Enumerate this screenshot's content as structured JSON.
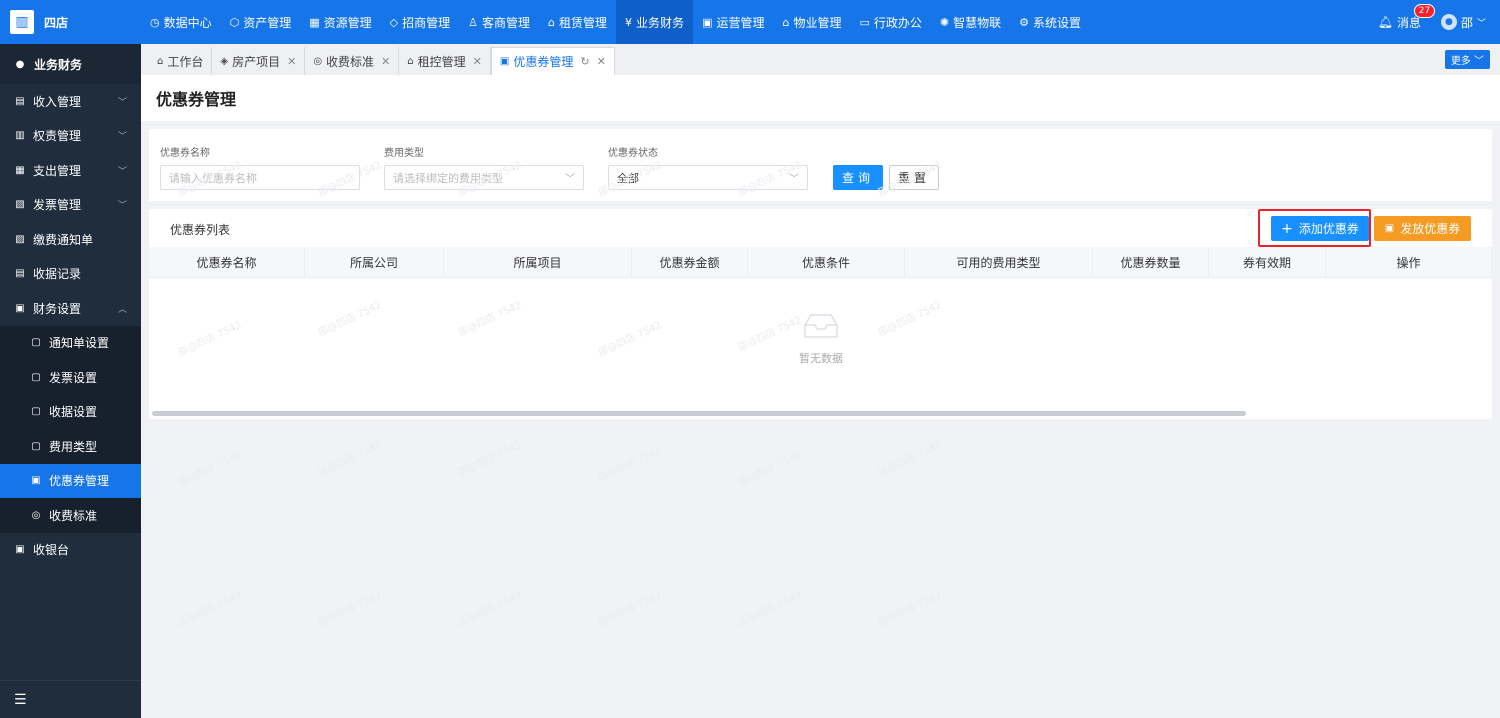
{
  "app": {
    "name": "四店"
  },
  "topnav": [
    {
      "icon": "◷",
      "label": "数据中心"
    },
    {
      "icon": "⬡",
      "label": "资产管理"
    },
    {
      "icon": "▦",
      "label": "资源管理"
    },
    {
      "icon": "◇",
      "label": "招商管理"
    },
    {
      "icon": "♙",
      "label": "客商管理"
    },
    {
      "icon": "⌂",
      "label": "租赁管理"
    },
    {
      "icon": "¥",
      "label": "业务财务",
      "active": true
    },
    {
      "icon": "▣",
      "label": "运营管理"
    },
    {
      "icon": "⌂",
      "label": "物业管理"
    },
    {
      "icon": "▭",
      "label": "行政办公"
    },
    {
      "icon": "✺",
      "label": "智慧物联"
    },
    {
      "icon": "⚙",
      "label": "系统设置"
    }
  ],
  "header_right": {
    "message_label": "消息",
    "message_count": "27",
    "user_name": "邵"
  },
  "sidebar": {
    "head": "业务财务",
    "items": [
      {
        "label": "收入管理",
        "arrow": "﹀"
      },
      {
        "label": "权责管理",
        "arrow": "﹀"
      },
      {
        "label": "支出管理",
        "arrow": "﹀"
      },
      {
        "label": "发票管理",
        "arrow": "﹀"
      },
      {
        "label": "缴费通知单",
        "arrow": ""
      },
      {
        "label": "收据记录",
        "arrow": ""
      },
      {
        "label": "财务设置",
        "arrow": "︿"
      }
    ],
    "subitems": [
      {
        "label": "通知单设置"
      },
      {
        "label": "发票设置"
      },
      {
        "label": "收据设置"
      },
      {
        "label": "费用类型"
      },
      {
        "label": "优惠券管理",
        "active": true
      },
      {
        "label": "收费标准"
      }
    ],
    "last": "收银台"
  },
  "tabs": [
    {
      "label": "工作台"
    },
    {
      "label": "房产项目"
    },
    {
      "label": "收费标准"
    },
    {
      "label": "租控管理"
    },
    {
      "label": "优惠券管理",
      "active": true
    }
  ],
  "more_label": "更多 ﹀",
  "page_title": "优惠券管理",
  "filters": {
    "name_label": "优惠券名称",
    "name_placeholder": "请输入优惠券名称",
    "type_label": "费用类型",
    "type_placeholder": "请选择绑定的费用类型",
    "status_label": "优惠券状态",
    "status_value": "全部",
    "query_label": "查询",
    "reset_label": "重置"
  },
  "list": {
    "title": "优惠券列表",
    "add_label": "添加优惠券",
    "issue_label": "发放优惠券",
    "columns": [
      "优惠券名称",
      "所属公司",
      "所属项目",
      "优惠券金额",
      "优惠条件",
      "可用的费用类型",
      "优惠券数量",
      "券有效期",
      "操作"
    ],
    "empty_text": "暂无数据"
  },
  "watermark": "邵@四店 7542"
}
